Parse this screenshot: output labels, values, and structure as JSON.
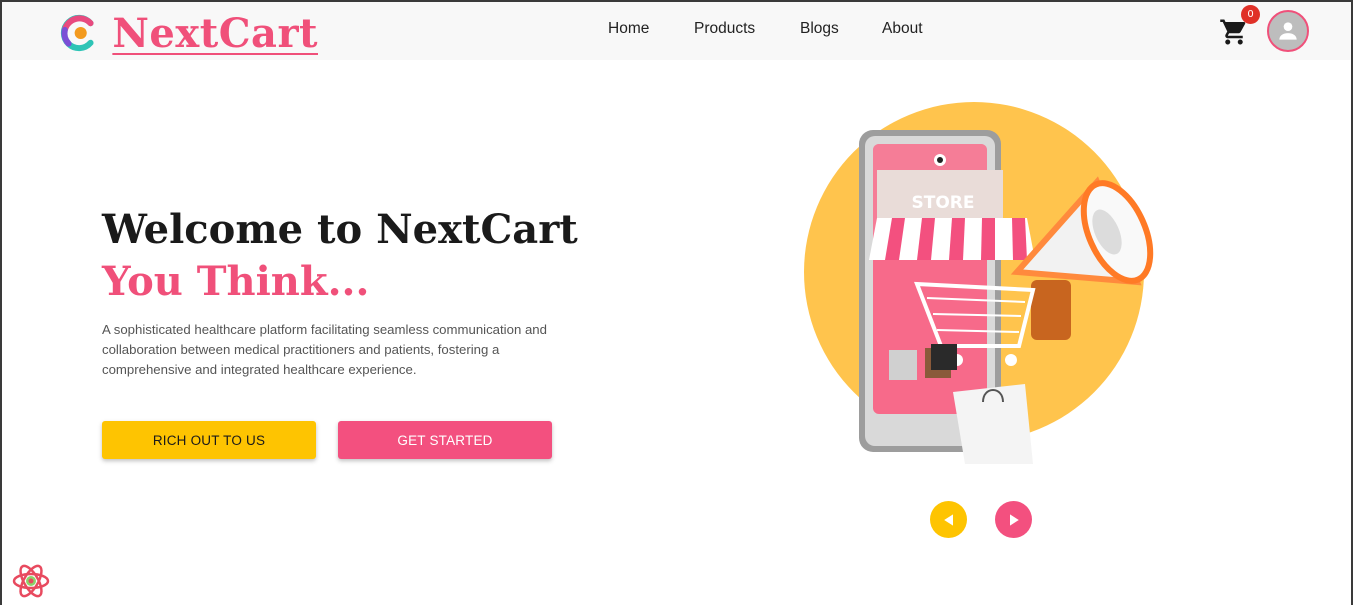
{
  "header": {
    "brand": "NextCart",
    "nav": [
      "Home",
      "Products",
      "Blogs",
      "About"
    ],
    "cart_count": "0",
    "icons": {
      "cart": "shopping-cart-icon",
      "avatar": "user-avatar-icon"
    }
  },
  "hero": {
    "title": "Welcome to NextCart",
    "subtitle": "You Think...",
    "description": "A sophisticated healthcare platform facilitating seamless communication and collaboration between medical practitioners and patients, fostering a comprehensive and integrated healthcare experience.",
    "primary_button": "RICH OUT TO US",
    "secondary_button": "GET STARTED",
    "image_label": "STORE"
  },
  "carousel": {
    "prev_icon": "triangle-left-icon",
    "next_icon": "triangle-right-icon"
  },
  "colors": {
    "pink": "#f3507f",
    "yellow": "#fec401",
    "dark": "#1a1a1a"
  }
}
